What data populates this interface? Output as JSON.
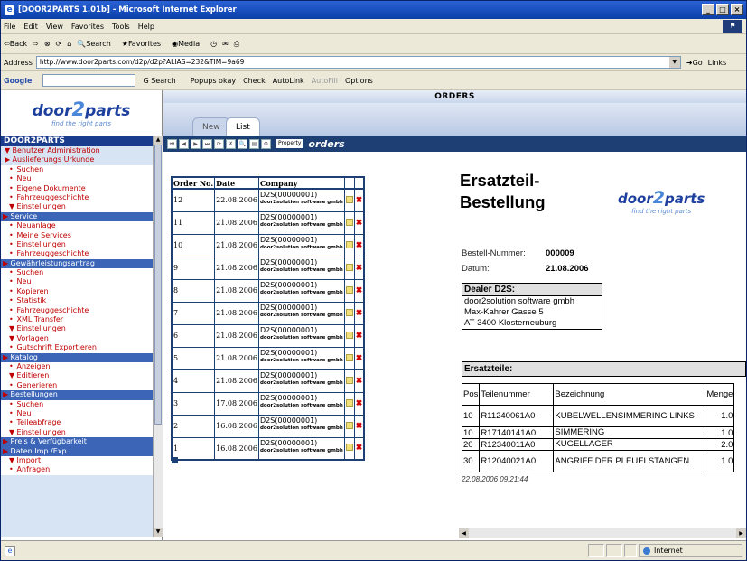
{
  "window": {
    "title": "[DOOR2PARTS 1.01b] - Microsoft Internet Explorer"
  },
  "menu": [
    "File",
    "Edit",
    "View",
    "Favorites",
    "Tools",
    "Help"
  ],
  "toolbar": {
    "back": "⇦Back",
    "search": "Search",
    "favorites": "Favorites",
    "media": "Media"
  },
  "address": {
    "label": "Address",
    "url": "http://www.door2parts.com/d2p/d2p?ALIAS=232&TIM=9a69",
    "go": "Go",
    "links": "Links"
  },
  "googlebar": {
    "logo": "Google",
    "search": "Search",
    "popups": "Popups okay",
    "check": "Check",
    "autolink": "AutoLink",
    "autofill": "AutoFill",
    "options": "Options"
  },
  "logo": {
    "part1": "door",
    "part2": "2",
    "part3": "parts",
    "tagline": "find the right parts"
  },
  "nav": {
    "header": "DOOR2PARTS",
    "items": [
      {
        "label": "Benutzer Administration",
        "kind": "lvl1",
        "arrow": "▼"
      },
      {
        "label": "Auslieferungs Urkunde",
        "kind": "lvl1",
        "arrow": "▶"
      },
      {
        "label": "Suchen",
        "kind": "sub",
        "arrow": "•"
      },
      {
        "label": "Neu",
        "kind": "sub",
        "arrow": "•"
      },
      {
        "label": "Eigene Dokumente",
        "kind": "sub",
        "arrow": "•"
      },
      {
        "label": "Fahrzeuggeschichte",
        "kind": "sub",
        "arrow": "•"
      },
      {
        "label": "Einstellungen",
        "kind": "sub",
        "arrow": "▼"
      },
      {
        "label": "Service",
        "kind": "sec",
        "arrow": "▶"
      },
      {
        "label": "Neuanlage",
        "kind": "sub",
        "arrow": "•"
      },
      {
        "label": "Meine Services",
        "kind": "sub",
        "arrow": "•"
      },
      {
        "label": "Einstellungen",
        "kind": "sub",
        "arrow": "•"
      },
      {
        "label": "Fahrzeuggeschichte",
        "kind": "sub",
        "arrow": "•"
      },
      {
        "label": "Gewährleistungsantrag",
        "kind": "sec",
        "arrow": "▶"
      },
      {
        "label": "Suchen",
        "kind": "sub",
        "arrow": "•"
      },
      {
        "label": "Neu",
        "kind": "sub",
        "arrow": "•"
      },
      {
        "label": "Kopieren",
        "kind": "sub",
        "arrow": "•"
      },
      {
        "label": "Statistik",
        "kind": "sub",
        "arrow": "•"
      },
      {
        "label": "Fahrzeuggeschichte",
        "kind": "sub",
        "arrow": "•"
      },
      {
        "label": "XML Transfer",
        "kind": "sub",
        "arrow": "•"
      },
      {
        "label": "Einstellungen",
        "kind": "sub",
        "arrow": "▼"
      },
      {
        "label": "Vorlagen",
        "kind": "sub",
        "arrow": "▼"
      },
      {
        "label": "Gutschrift Exportieren",
        "kind": "sub",
        "arrow": "•"
      },
      {
        "label": "Katalog",
        "kind": "sec",
        "arrow": "▶"
      },
      {
        "label": "Anzeigen",
        "kind": "sub",
        "arrow": "•"
      },
      {
        "label": "Editieren",
        "kind": "sub",
        "arrow": "▼"
      },
      {
        "label": "Generieren",
        "kind": "sub",
        "arrow": "•"
      },
      {
        "label": "Bestellungen",
        "kind": "sec",
        "arrow": "▶"
      },
      {
        "label": "Suchen",
        "kind": "sub",
        "arrow": "•"
      },
      {
        "label": "Neu",
        "kind": "sub",
        "arrow": "•"
      },
      {
        "label": "Teileabfrage",
        "kind": "sub",
        "arrow": "•"
      },
      {
        "label": "Einstellungen",
        "kind": "sub",
        "arrow": "▼"
      },
      {
        "label": "Preis & Verfügbarkeit",
        "kind": "sec",
        "arrow": "▶"
      },
      {
        "label": "Daten Imp./Exp.",
        "kind": "sec",
        "arrow": "▶"
      },
      {
        "label": "Import",
        "kind": "sub",
        "arrow": "▼"
      },
      {
        "label": "Anfragen",
        "kind": "sub",
        "arrow": "•"
      }
    ]
  },
  "main": {
    "header": "ORDERS",
    "tabs": {
      "new": "New",
      "list": "List"
    },
    "toolbar": {
      "property": "Property",
      "title": "orders"
    },
    "table": {
      "headers": [
        "Order No.",
        "Date",
        "Company"
      ],
      "rows": [
        {
          "no": "12",
          "date": "22.08.2006",
          "company": "D2S(00000001)",
          "sub": "door2solution software gmbh"
        },
        {
          "no": "11",
          "date": "21.08.2006",
          "company": "D2S(00000001)",
          "sub": "door2solution software gmbh"
        },
        {
          "no": "10",
          "date": "21.08.2006",
          "company": "D2S(00000001)",
          "sub": "door2solution software gmbh"
        },
        {
          "no": "9",
          "date": "21.08.2006",
          "company": "D2S(00000001)",
          "sub": "door2solution software gmbh"
        },
        {
          "no": "8",
          "date": "21.08.2006",
          "company": "D2S(00000001)",
          "sub": "door2solution software gmbh"
        },
        {
          "no": "7",
          "date": "21.08.2006",
          "company": "D2S(00000001)",
          "sub": "door2solution software gmbh"
        },
        {
          "no": "6",
          "date": "21.08.2006",
          "company": "D2S(00000001)",
          "sub": "door2solution software gmbh"
        },
        {
          "no": "5",
          "date": "21.08.2006",
          "company": "D2S(00000001)",
          "sub": "door2solution software gmbh"
        },
        {
          "no": "4",
          "date": "21.08.2006",
          "company": "D2S(00000001)",
          "sub": "door2solution software gmbh"
        },
        {
          "no": "3",
          "date": "17.08.2006",
          "company": "D2S(00000001)",
          "sub": "door2solution software gmbh"
        },
        {
          "no": "2",
          "date": "16.08.2006",
          "company": "D2S(00000001)",
          "sub": "door2solution software gmbh"
        },
        {
          "no": "1",
          "date": "16.08.2006",
          "company": "D2S(00000001)",
          "sub": "door2solution software gmbh"
        }
      ]
    },
    "doc": {
      "title_line1": "Ersatzteil-",
      "title_line2": "Bestellung",
      "order_label": "Bestell-Nummer:",
      "order_value": "000009",
      "date_label": "Datum:",
      "date_value": "21.08.2006",
      "dealer_header": "Dealer D2S:",
      "dealer_lines": [
        "door2solution software gmbh",
        "Max-Kahrer Gasse 5",
        "AT-3400  Klosterneuburg"
      ],
      "parts_header": "Ersatzteile:",
      "parts_cols": [
        "Pos",
        "Teilenummer",
        "Bezeichnung",
        "Menge"
      ],
      "parts": [
        {
          "pos": "10",
          "nr": "R11240061A0",
          "bez": "KUBELWELLENSIMMERING LINKS",
          "menge": "1.0",
          "strike": true
        },
        {
          "pos": "10",
          "nr": "R17140141A0",
          "bez": "SIMMERING",
          "menge": "1.0",
          "strike": false
        },
        {
          "pos": "20",
          "nr": "R12340011A0",
          "bez": "KUGELLAGER",
          "menge": "2.0",
          "strike": false
        },
        {
          "pos": "30",
          "nr": "R12040021A0",
          "bez": "ANGRIFF DER PLEUELSTANGEN",
          "menge": "1.0",
          "strike": false
        }
      ],
      "timestamp": "22.08.2006 09:21:44"
    }
  },
  "status": {
    "zone": "Internet"
  }
}
